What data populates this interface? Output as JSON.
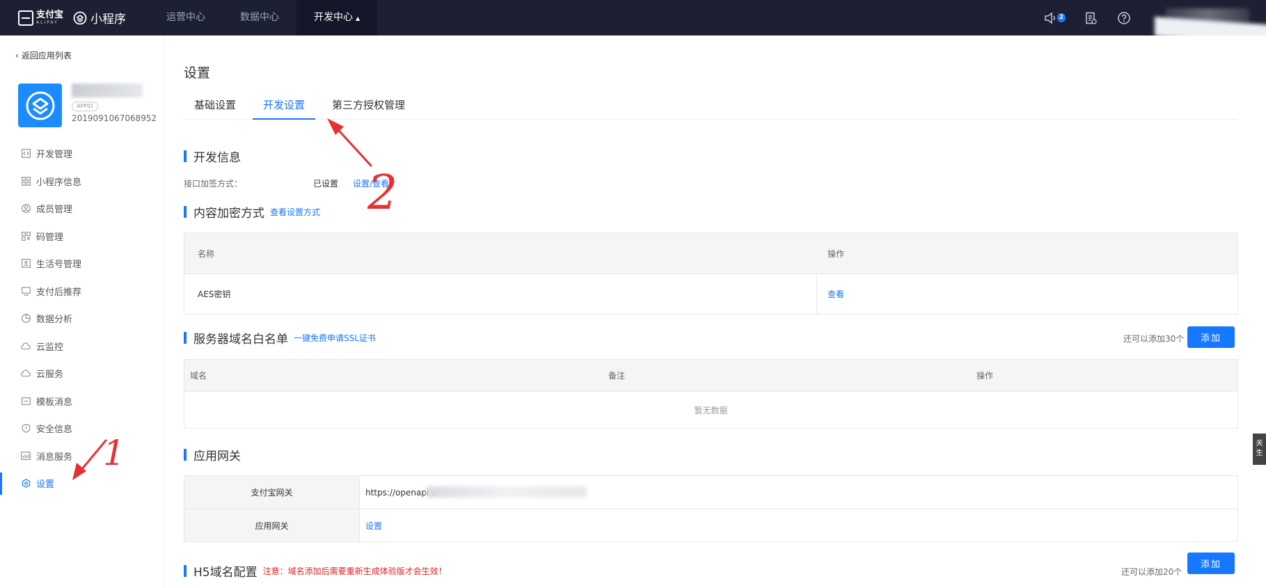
{
  "topbar": {
    "alipay_cn": "支付宝",
    "alipay_en": "ALIPAY",
    "product": "小程序",
    "nav": [
      {
        "label": "运营中心",
        "active": false
      },
      {
        "label": "数据中心",
        "active": false
      },
      {
        "label": "开发中心",
        "active": true
      }
    ],
    "notify_count": "2"
  },
  "sidebar": {
    "back": "返回应用列表",
    "appid_tag": "APPID",
    "app_id": "2019091067068952",
    "items": [
      {
        "label": "开发管理",
        "icon": "code-icon"
      },
      {
        "label": "小程序信息",
        "icon": "grid-icon"
      },
      {
        "label": "成员管理",
        "icon": "user-icon"
      },
      {
        "label": "码管理",
        "icon": "qrcode-icon"
      },
      {
        "label": "生活号管理",
        "icon": "account-icon"
      },
      {
        "label": "支付后推荐",
        "icon": "monitor-icon"
      },
      {
        "label": "数据分析",
        "icon": "pie-icon"
      },
      {
        "label": "云监控",
        "icon": "cloud-icon"
      },
      {
        "label": "云服务",
        "icon": "cloud-icon"
      },
      {
        "label": "模板消息",
        "icon": "message-icon"
      },
      {
        "label": "安全信息",
        "icon": "shield-icon"
      },
      {
        "label": "消息服务",
        "icon": "chart-icon"
      },
      {
        "label": "设置",
        "icon": "gear-icon",
        "active": true
      }
    ]
  },
  "main": {
    "title": "设置",
    "tabs": [
      "基础设置",
      "开发设置",
      "第三方授权管理"
    ],
    "dev_info": {
      "title": "开发信息",
      "label": "接口加签方式：",
      "value": "已设置",
      "link": "设置/查看"
    },
    "content_enc": {
      "title": "内容加密方式",
      "link": "查看设置方式",
      "headers": [
        "名称",
        "操作"
      ],
      "rows": [
        {
          "name": "AES密钥",
          "action": "查看"
        }
      ]
    },
    "server_domain": {
      "title": "服务器域名白名单",
      "link": "一键免费申请SSL证书",
      "count": "还可以添加30个",
      "add": "添加",
      "headers": [
        "域名",
        "备注",
        "操作"
      ],
      "empty": "暂无数据"
    },
    "gateway": {
      "title": "应用网关",
      "rows": [
        {
          "key": "支付宝网关",
          "value": "https://openapi.a"
        },
        {
          "key": "应用网关",
          "value": "设置"
        }
      ]
    },
    "h5_domain": {
      "title": "H5域名配置",
      "warn": "注意：域名添加后需要重新生成体验版才会生效！",
      "count": "还可以添加20个",
      "add": "添加"
    }
  },
  "float_tab": "关生",
  "annotations": {
    "num1": "1",
    "num2": "2"
  }
}
